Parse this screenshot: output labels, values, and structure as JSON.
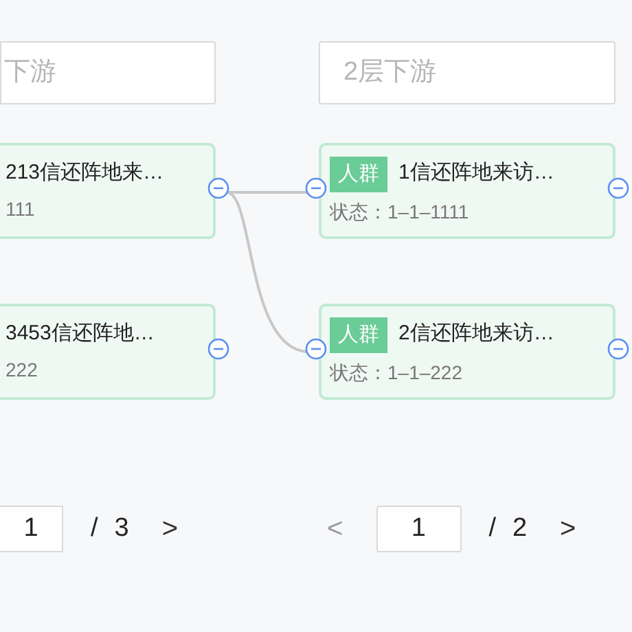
{
  "columns": [
    {
      "search": {
        "placeholder": "下游"
      },
      "nodes": [
        {
          "title": "213信还阵地来…",
          "status": "111"
        },
        {
          "title": "3453信还阵地…",
          "status": "222"
        }
      ],
      "pagination": {
        "page": "1",
        "separator": "/",
        "total": "3",
        "next": {
          "label": ">",
          "disabled": false
        }
      }
    },
    {
      "search": {
        "placeholder": "2层下游"
      },
      "nodes": [
        {
          "tag": "人群",
          "title": "1信还阵地来访…",
          "status": "状态：1–1–1111"
        },
        {
          "tag": "人群",
          "title": "2信还阵地来访…",
          "status": "状态：1–1–222"
        }
      ],
      "pagination": {
        "prev": {
          "label": "<",
          "disabled": true
        },
        "page": "1",
        "separator": "/",
        "total": "2",
        "next": {
          "label": ">",
          "disabled": false
        }
      }
    }
  ]
}
